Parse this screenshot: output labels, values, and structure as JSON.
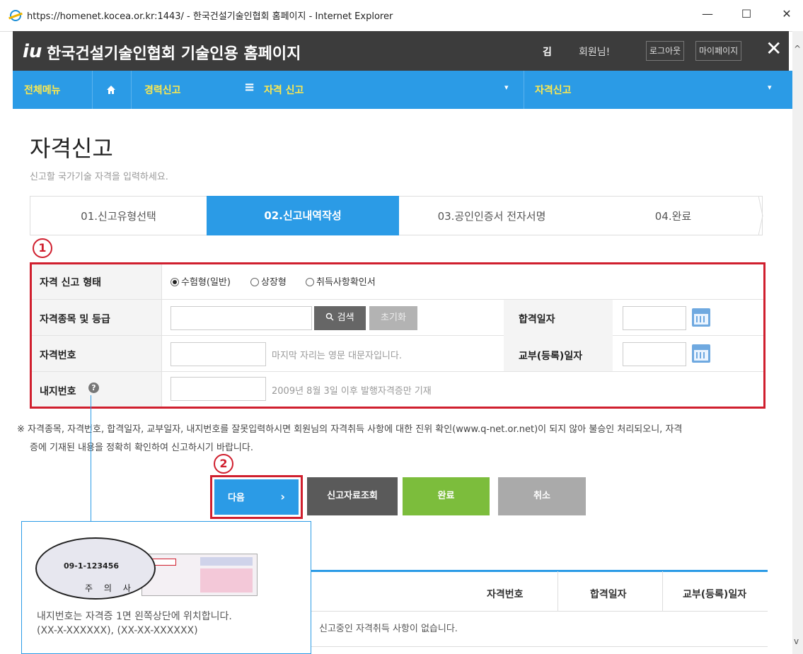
{
  "window": {
    "title": "https://homenet.kocea.or.kr:1443/ - 한국건설기술인협회 홈페이지 - Internet Explorer",
    "minimize": "—",
    "maximize": "☐",
    "close": "✕"
  },
  "header": {
    "logo": "iu",
    "title": "한국건설기술인협회 기술인용 홈페이지",
    "user_name": "김",
    "user_suffix": "회원님!",
    "logout": "로그아웃",
    "mypage": "마이페이지",
    "close": "✕"
  },
  "nav": {
    "all_menu": "전체메뉴",
    "home_icon": "home-icon",
    "item1": "경력신고",
    "menu_icon": "≡",
    "item2": "자격 신고",
    "item3": "자격신고",
    "arrow": "▾"
  },
  "page": {
    "title": "자격신고",
    "subtitle": "신고할 국가기술 자격을 입력하세요."
  },
  "steps": [
    "01.신고유형선택",
    "02.신고내역작성",
    "03.공인인증서 전자서명",
    "04.완료"
  ],
  "annotations": {
    "one": "1",
    "two": "2"
  },
  "form": {
    "type_label": "자격 신고 형태",
    "radio_options": [
      "수험형(일반)",
      "상장형",
      "취득사항확인서"
    ],
    "kind_label": "자격종목 및 등급",
    "kind_value": "",
    "search_button": "검색",
    "reset_button": "초기화",
    "pass_date_label": "합격일자",
    "number_label": "자격번호",
    "number_hint": "마지막 자리는 영문 대문자입니다.",
    "issue_date_label": "교부(등록)일자",
    "inner_label": "내지번호",
    "inner_hint": "2009년 8월 3일 이후 발행자격증만 기재"
  },
  "notice": {
    "line1": "※ 자격종목, 자격번호, 합격일자, 교부일자, 내지번호를 잘못입력하시면 회원님의 자격취득 사항에 대한 진위 확인(www.q-net.or.net)이 되지 않아 불승인 처리되오니, 자격",
    "line2": "증에 기재된 내용을 정확히 확인하여 신고하시기 바랍니다."
  },
  "actions": {
    "next": "다음",
    "next_arrow": "›",
    "lookup": "신고자료조회",
    "done": "완료",
    "cancel": "취소"
  },
  "table": {
    "headers": [
      "자격번호",
      "합격일자",
      "교부(등록)일자"
    ],
    "empty": "신고중인 자격취득 사항이 없습니다."
  },
  "tooltip": {
    "sample_number": "09-1-123456",
    "sample_caution": "주 의 사",
    "text1": "내지번호는 자격증 1면 왼쪽상단에 위치합니다.",
    "text2": "(XX-X-XXXXXX), (XX-XX-XXXXXX)"
  },
  "colors": {
    "accent_blue": "#2b9be6",
    "header_dark": "#3c3c3c",
    "highlight_red": "#d01f2e",
    "done_green": "#7cbd3c"
  }
}
